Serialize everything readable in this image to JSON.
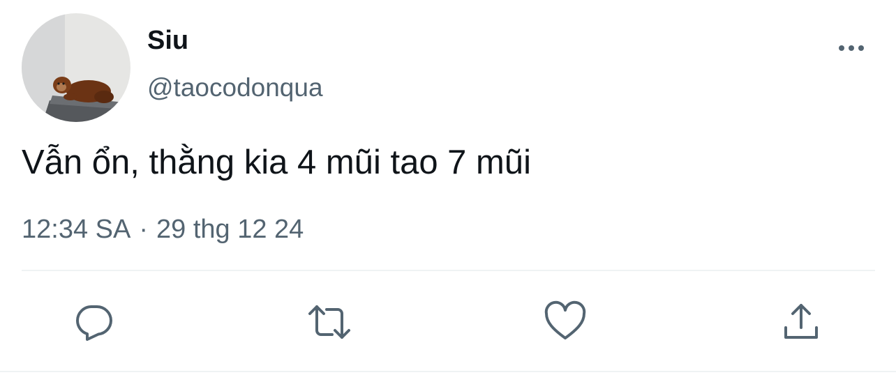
{
  "user": {
    "display_name": "Siu",
    "handle": "@taocodonqua",
    "avatar": "orangutan-plush-avatar"
  },
  "tweet": {
    "text": "Vẫn ổn, thằng kia 4 mũi tao 7 mũi",
    "time": "12:34 SA",
    "separator": "·",
    "date": "29 thg 12 24"
  },
  "icons": {
    "more": "more-horizontal-icon",
    "reply": "reply-icon",
    "retweet": "retweet-icon",
    "like": "heart-icon",
    "share": "share-icon"
  },
  "colors": {
    "text_primary": "#0f1419",
    "text_secondary": "#536471",
    "divider": "#eff3f4"
  }
}
